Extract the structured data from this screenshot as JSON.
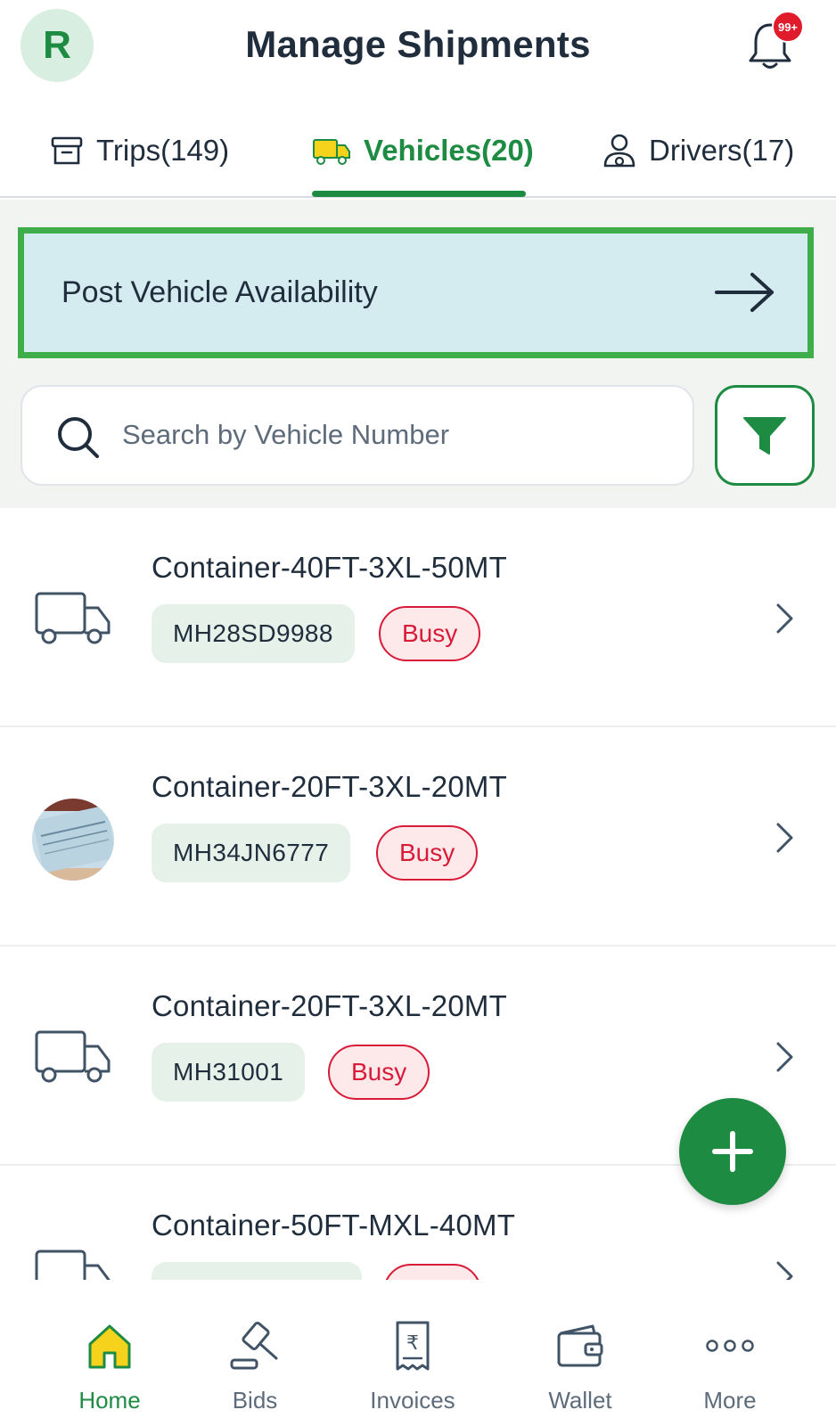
{
  "header": {
    "avatar_initial": "R",
    "title": "Manage Shipments",
    "notification_count": "99+"
  },
  "tabs": [
    {
      "label": "Trips(149)",
      "icon": "archive-box-icon",
      "active": false
    },
    {
      "label": "Vehicles(20)",
      "icon": "truck-icon",
      "active": true
    },
    {
      "label": "Drivers(17)",
      "icon": "driver-icon",
      "active": false
    }
  ],
  "post_availability": {
    "label": "Post Vehicle Availability"
  },
  "search": {
    "placeholder": "Search by Vehicle Number"
  },
  "vehicles": [
    {
      "name": "Container-40FT-3XL-50MT",
      "plate": "MH28SD9988",
      "status": "Busy",
      "thumbnail": "truck-icon"
    },
    {
      "name": "Container-20FT-3XL-20MT",
      "plate": "MH34JN6777",
      "status": "Busy",
      "thumbnail": "vehicle-photo"
    },
    {
      "name": "Container-20FT-3XL-20MT",
      "plate": "MH31001",
      "status": "Busy",
      "thumbnail": "truck-icon"
    },
    {
      "name": "Container-50FT-MXL-40MT",
      "plate": "",
      "status": "",
      "thumbnail": "truck-icon"
    }
  ],
  "bottom_nav": [
    {
      "label": "Home",
      "icon": "home-icon",
      "active": true
    },
    {
      "label": "Bids",
      "icon": "gavel-icon",
      "active": false
    },
    {
      "label": "Invoices",
      "icon": "invoice-icon",
      "active": false
    },
    {
      "label": "Wallet",
      "icon": "wallet-icon",
      "active": false
    },
    {
      "label": "More",
      "icon": "more-icon",
      "active": false
    }
  ],
  "colors": {
    "brand_green": "#1e8b43",
    "busy_red": "#d81b38",
    "banner_bg": "#d4ecef",
    "banner_border": "#3fae4a",
    "home_yellow": "#f5d31d"
  }
}
